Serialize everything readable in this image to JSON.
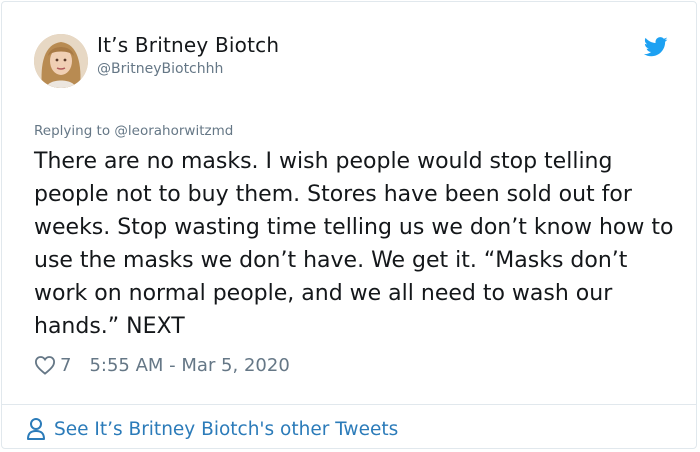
{
  "author": {
    "display_name": "It’s Britney Biotch",
    "handle": "@BritneyBiotchhh",
    "avatar_icon": "profile-photo",
    "brand_icon": "twitter-bird-icon"
  },
  "reply": {
    "prefix": "Replying to ",
    "mention": "@leorahorwitzmd"
  },
  "tweet": {
    "text": "There are no masks. I wish people would stop telling people not to buy them. Stores have been sold out for weeks. Stop wasting time telling us we don’t know how to use the masks we don’t have. We get it. “Masks don’t work on normal people, and we all need to wash our hands.” NEXT"
  },
  "meta": {
    "like_icon": "heart-icon",
    "likes": "7",
    "timestamp": "5:55 AM - Mar 5, 2020"
  },
  "footer": {
    "icon": "person-icon",
    "label": "See It’s Britney Biotch's other Tweets"
  },
  "colors": {
    "text": "#14171a",
    "secondary": "#657786",
    "link": "#2b7bb9",
    "brand": "#1da1f2",
    "border": "#e1e8ed"
  }
}
